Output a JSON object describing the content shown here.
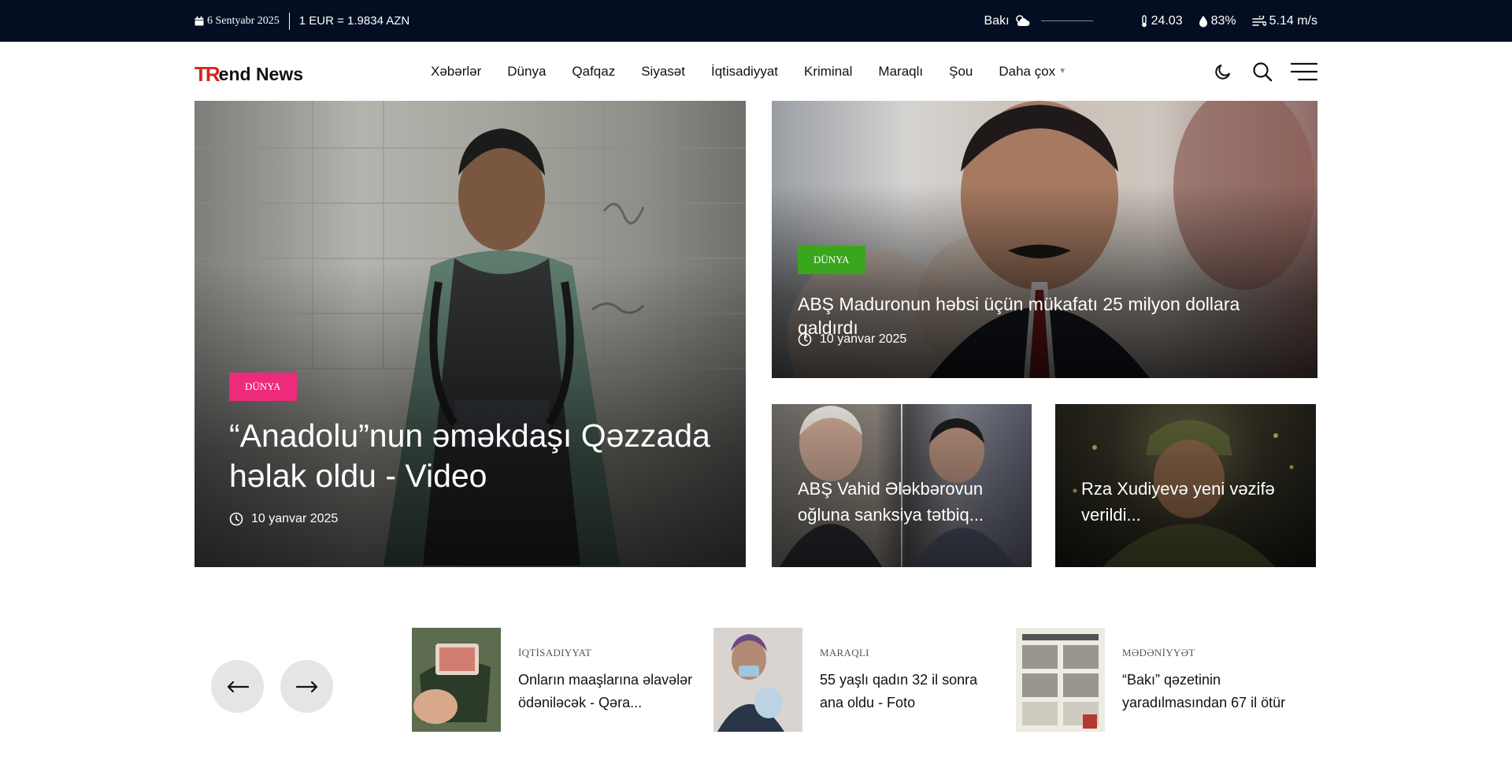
{
  "topbar": {
    "date": "6 Sentyabr 2025",
    "rate": "1 EUR = 1.9834 AZN",
    "city": "Bakı",
    "temperature": "24.03",
    "humidity": "83%",
    "wind": "5.14 m/s"
  },
  "header": {
    "logo_mark": "TR",
    "logo_text": "end News",
    "nav": [
      "Xəbərlər",
      "Dünya",
      "Qafqaz",
      "Siyasət",
      "İqtisadiyyat",
      "Kriminal",
      "Maraqlı",
      "Şou",
      "Daha çox"
    ],
    "icons": [
      "moon-icon",
      "search-icon",
      "menu-icon"
    ]
  },
  "hero": {
    "main": {
      "badge": "DÜNYA",
      "badge_color": "#ee2a7b",
      "title": "“Anadolu”nun əməkdaşı Qəzzada həlak oldu - Video",
      "date": "10 yanvar 2025"
    },
    "top": {
      "badge": "DÜNYA",
      "badge_color": "#3aa61d",
      "title": "ABŞ Maduronun həbsi üçün mükafatı 25 milyon dollara qaldırdı",
      "date": "10 yanvar 2025"
    },
    "small": [
      {
        "title": "ABŞ Vahid Ələkbərovun oğluna sanksiya tətbiq..."
      },
      {
        "title": "Rza Xudiyevə yeni vəzifə verildi..."
      }
    ]
  },
  "slider": {
    "prev_icon": "arrow-left-icon",
    "next_icon": "arrow-right-icon",
    "items": [
      {
        "category": "İQTİSADIYYAT",
        "title": "Onların maaşlarına əlavələr ödəniləcək - Qəra..."
      },
      {
        "category": "MARAQLI",
        "title": "55 yaşlı qadın 32 il sonra ana oldu - Foto"
      },
      {
        "category": "MƏDƏNİYYƏT",
        "title": "“Bakı” qəzetinin yaradılmasından 67 il ötür"
      }
    ]
  }
}
